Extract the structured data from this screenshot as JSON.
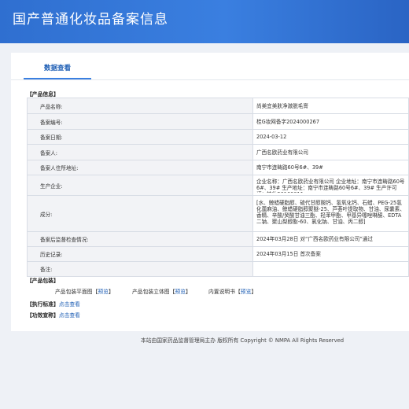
{
  "header": {
    "title": "国产普通化妆品备案信息"
  },
  "tab": {
    "label": "数据查看"
  },
  "info_section": {
    "heading": "【产品信息】",
    "rows": [
      {
        "label": "产品名称:",
        "value": "尚美宜美肤净澈脱毛膏"
      },
      {
        "label": "备案编号:",
        "value": "桂G妆网备字2024000267"
      },
      {
        "label": "备案日期:",
        "value": "2024-03-12"
      },
      {
        "label": "备案人:",
        "value": "广西名欧药业有限公司"
      },
      {
        "label": "备案人住所地址:",
        "value": "南宁市连畴路60号6#、39#"
      },
      {
        "label": "生产企业:",
        "value": "企业名称：广西名欧药业有限公司 企业地址：南宁市连畴路60号6#、39# 生产地址：南宁市连畴路60号6#、39# 生产许可证：桂妆20160011"
      },
      {
        "label": "成分:",
        "value": "[水、鲸蜡硬脂醇、硫代甘醇酸钙、氢氧化钙、石蜡、PEG-25氢化蓖麻油、鲸蜡硬脂醇聚醚-25、芦荟叶提取物、甘油、尿囊素、香精、辛酸/癸酸甘油三酯、羟苯甲酯、甲基异噻唑啉酮、EDTA二钠、聚山梨醇酯-60、氯化钠、甘油、丙二醇]"
      },
      {
        "label": "备案后监督检查情况:",
        "value": "2024年03月28日 对“广西名欧药业有限公司”通过"
      },
      {
        "label": "历史记录:",
        "value": "2024年03月15日 首次备案"
      },
      {
        "label": "备注:",
        "value": ""
      }
    ]
  },
  "package_section": {
    "heading": "【产品包装】",
    "items": [
      {
        "label": "产品包装平面图",
        "link": "预览"
      },
      {
        "label": "产品包装立体图",
        "link": "预览"
      },
      {
        "label": "内置说明书",
        "link": "预览"
      }
    ]
  },
  "standard": {
    "key": "【执行标准】",
    "link": "点击查看"
  },
  "efficacy": {
    "key": "【功效宣称】",
    "link": "点击查看"
  },
  "footer": {
    "text": "本站由国家药品监督管理局主办 版权所有 Copyright © NMPA All Rights Reserved"
  }
}
